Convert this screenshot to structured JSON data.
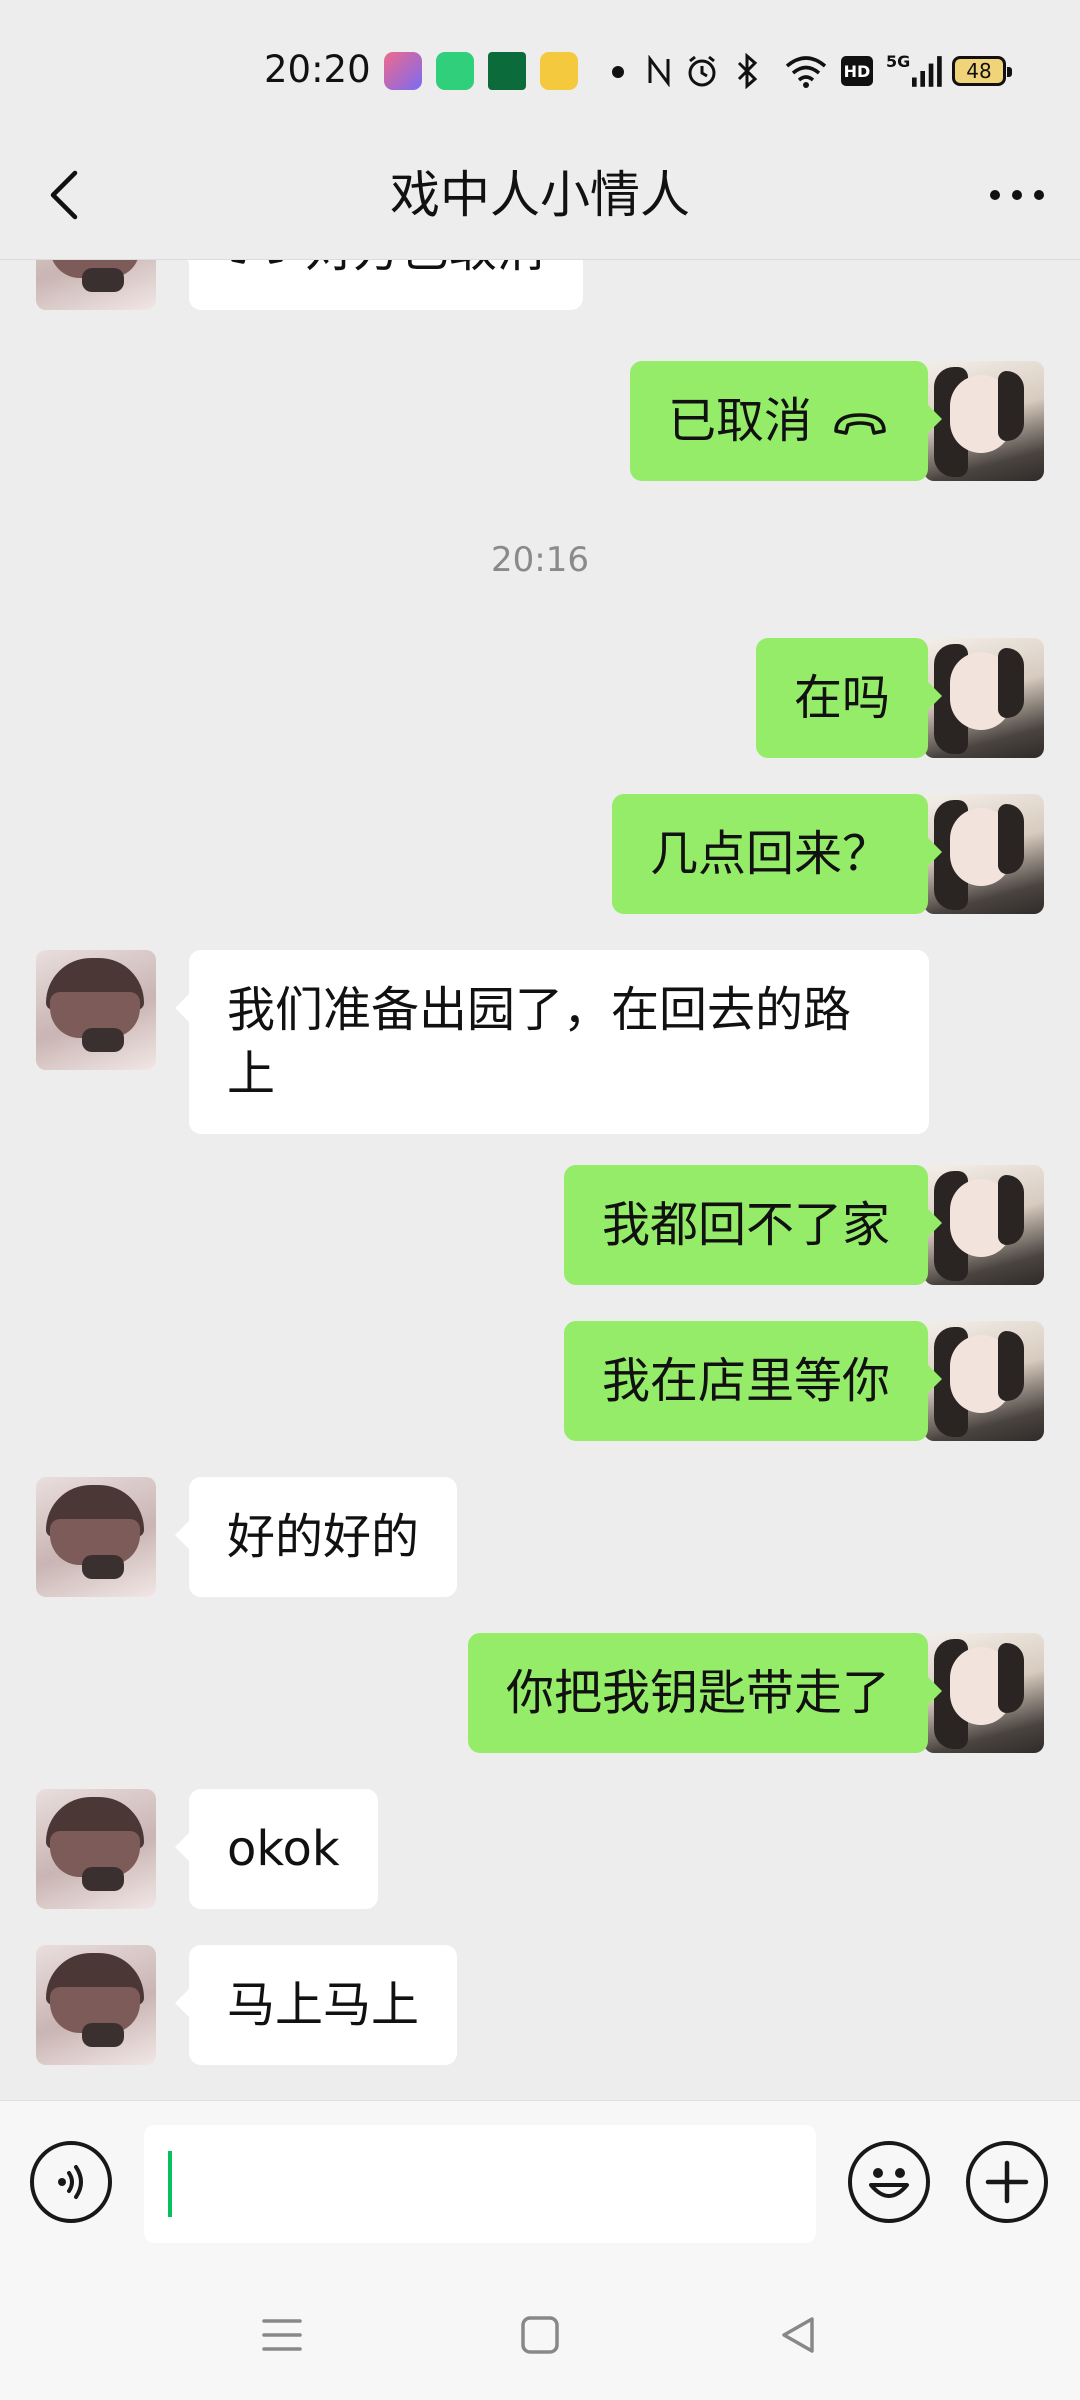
{
  "status_bar": {
    "time": "20:20",
    "network": "5G",
    "hd": "HD",
    "battery": "48",
    "icons": [
      "app-icon-pink",
      "app-icon-green",
      "app-icon-oppo",
      "app-icon-yellow",
      "dot-icon",
      "nfc-icon",
      "alarm-icon",
      "bluetooth-icon",
      "wifi-icon",
      "hd-icon",
      "signal-icon",
      "battery-icon"
    ]
  },
  "header": {
    "title": "戏中人小情人",
    "back_icon": "chevron-left-icon",
    "more_icon": "more-dots-icon"
  },
  "chat": {
    "messages": [
      {
        "side": "left",
        "text": "对方已取消",
        "icon": "phone-hangup-icon"
      },
      {
        "side": "right",
        "text": "已取消",
        "icon": "phone-hangup-icon"
      },
      {
        "type": "time",
        "text": "20:16"
      },
      {
        "side": "right",
        "text": "在吗"
      },
      {
        "side": "right",
        "text": "几点回来？"
      },
      {
        "side": "left",
        "text": "我们准备出园了，在回去的路上"
      },
      {
        "side": "right",
        "text": "我都回不了家"
      },
      {
        "side": "right",
        "text": "我在店里等你"
      },
      {
        "side": "left",
        "text": "好的好的"
      },
      {
        "side": "right",
        "text": "你把我钥匙带走了"
      },
      {
        "side": "left",
        "text": "okok"
      },
      {
        "side": "left",
        "text": "马上马上"
      }
    ]
  },
  "input_bar": {
    "voice_icon": "voice-icon",
    "text_value": "",
    "emoji_icon": "emoji-icon",
    "plus_icon": "plus-icon"
  },
  "nav_bar": {
    "icons": [
      "menu-icon",
      "home-square-icon",
      "back-triangle-icon"
    ]
  },
  "colors": {
    "background": "#ededed",
    "sent_bubble": "#95ec69",
    "received_bubble": "#ffffff",
    "caret": "#07c160"
  }
}
